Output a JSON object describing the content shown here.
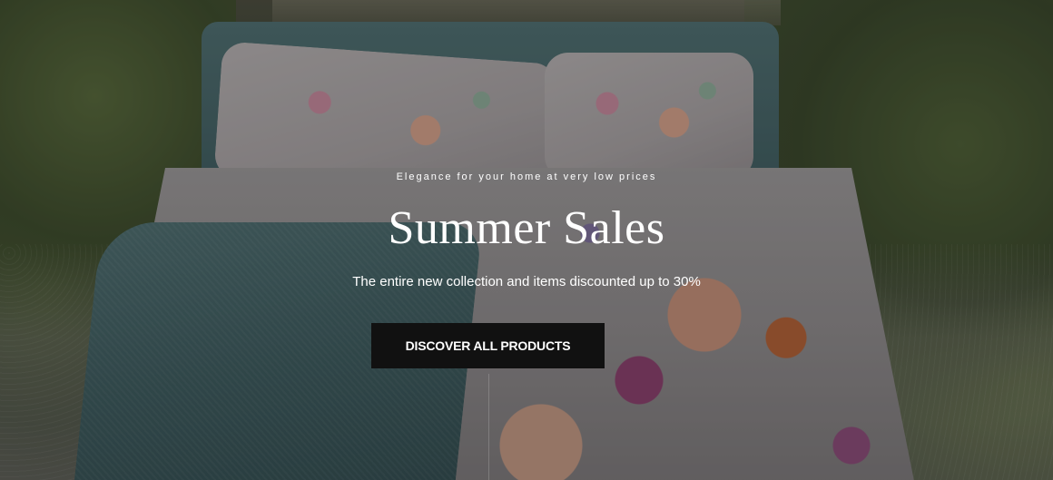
{
  "hero": {
    "tagline": "Elegance for your home at very low prices",
    "headline": "Summer Sales",
    "subline": "The entire new collection and items discounted up to 30%",
    "cta_label": "DISCOVER ALL PRODUCTS"
  },
  "colors": {
    "text": "#ffffff",
    "button_bg": "#111111",
    "button_text": "#ffffff"
  }
}
